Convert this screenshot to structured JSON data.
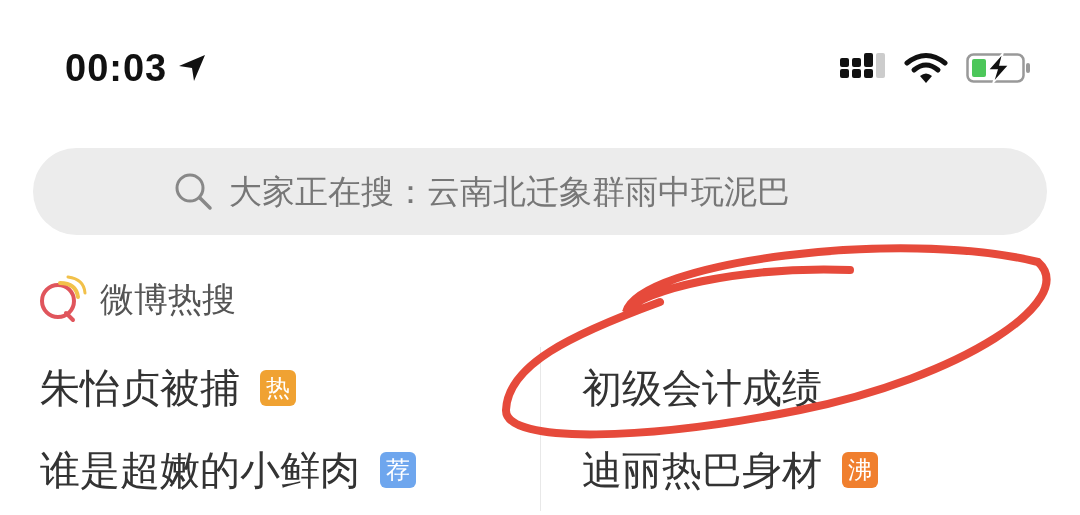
{
  "status_bar": {
    "time": "00:03"
  },
  "search": {
    "placeholder": "大家正在搜：云南北迁象群雨中玩泥巴"
  },
  "hot_search": {
    "title": "微博热搜",
    "items": [
      {
        "text": "朱怡贞被捕",
        "badge": "热",
        "color": "#f0a232"
      },
      {
        "text": "初级会计成绩"
      },
      {
        "text": "谁是超嫩的小鲜肉",
        "badge": "荐",
        "color": "#6ea6ee"
      },
      {
        "text": "迪丽热巴身材",
        "badge": "沸",
        "color": "#f07f2e"
      }
    ]
  }
}
